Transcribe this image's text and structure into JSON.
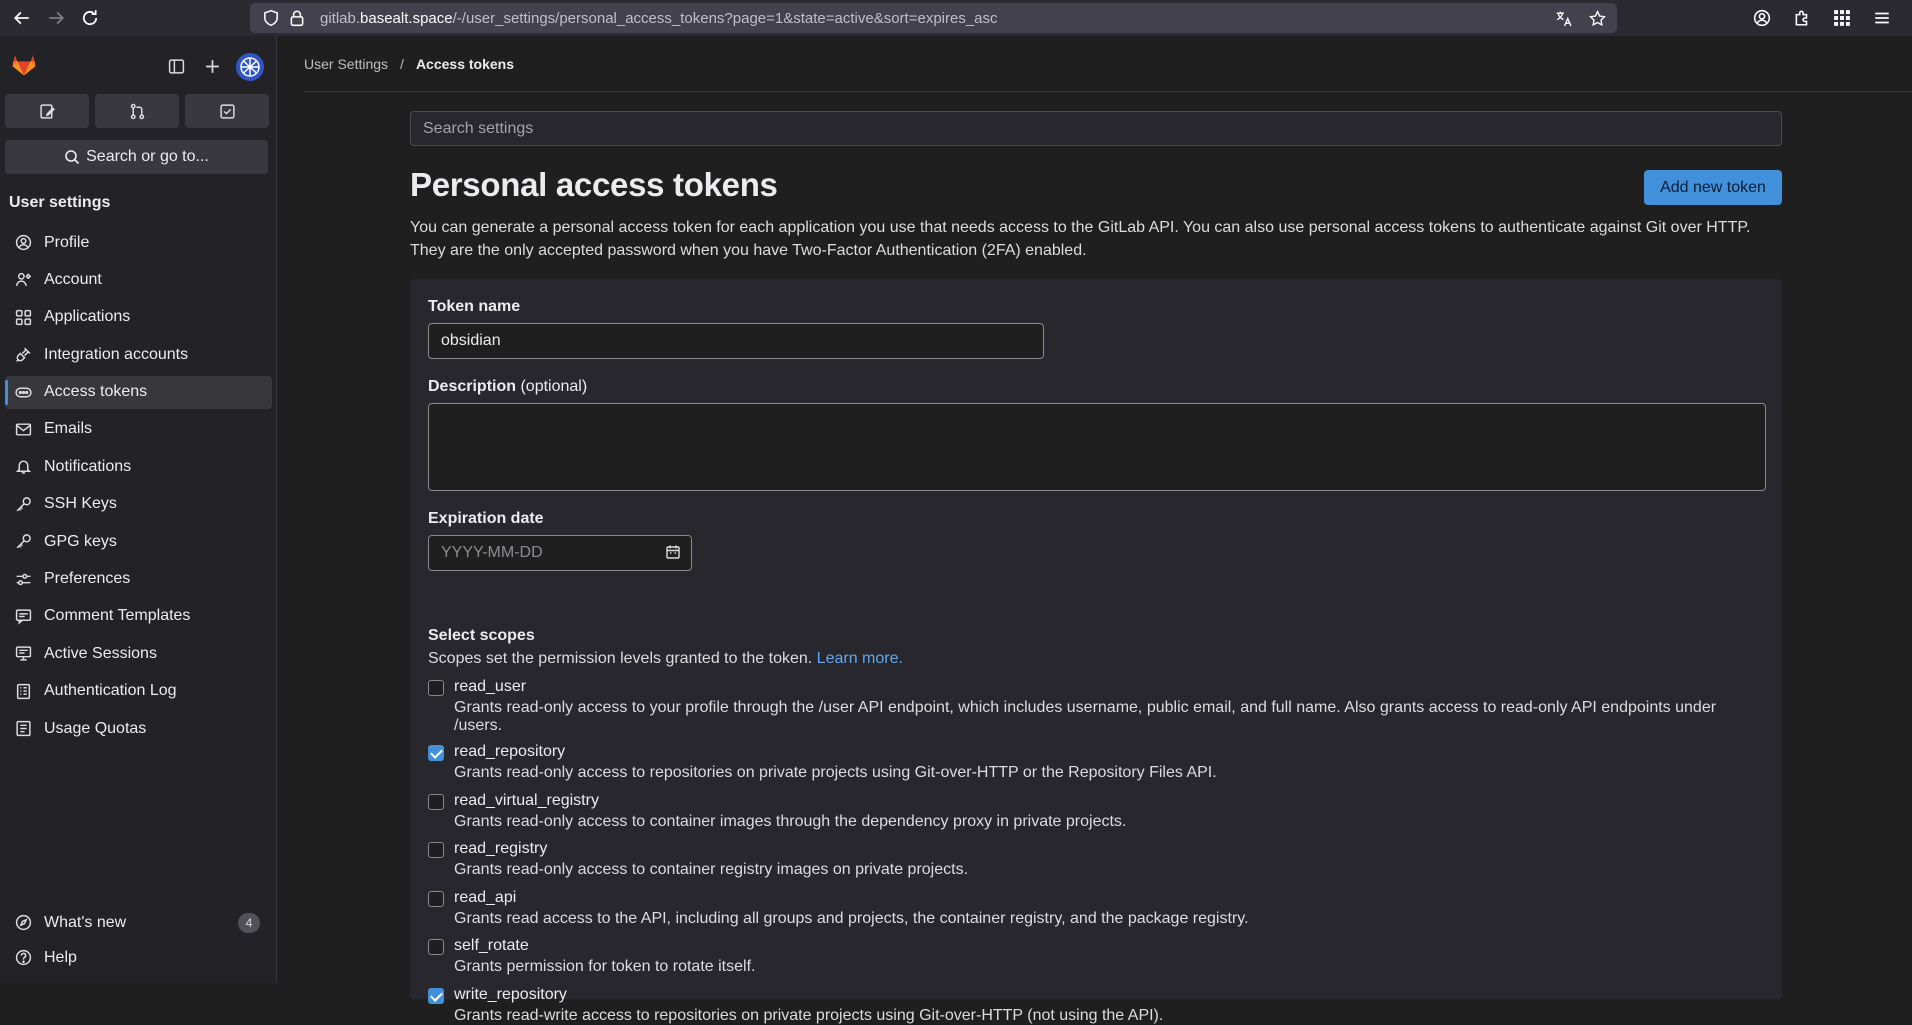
{
  "browser": {
    "url_prefix": "gitlab.",
    "url_domain": "basealt.space",
    "url_path": "/-/user_settings/personal_access_tokens?page=1&state=active&sort=expires_asc"
  },
  "sidebar": {
    "search_label": "Search or go to...",
    "title": "User settings",
    "items": [
      {
        "label": "Profile",
        "icon": "profile-icon"
      },
      {
        "label": "Account",
        "icon": "account-icon"
      },
      {
        "label": "Applications",
        "icon": "applications-icon"
      },
      {
        "label": "Integration accounts",
        "icon": "integration-icon"
      },
      {
        "label": "Access tokens",
        "icon": "token-icon",
        "active": true
      },
      {
        "label": "Emails",
        "icon": "mail-icon"
      },
      {
        "label": "Notifications",
        "icon": "bell-icon"
      },
      {
        "label": "SSH Keys",
        "icon": "key-icon"
      },
      {
        "label": "GPG keys",
        "icon": "key-icon"
      },
      {
        "label": "Preferences",
        "icon": "preferences-icon"
      },
      {
        "label": "Comment Templates",
        "icon": "comment-icon"
      },
      {
        "label": "Active Sessions",
        "icon": "monitor-icon"
      },
      {
        "label": "Authentication Log",
        "icon": "log-icon"
      },
      {
        "label": "Usage Quotas",
        "icon": "quota-icon"
      }
    ],
    "whats_new": "What's new",
    "whats_new_count": "4",
    "help": "Help"
  },
  "breadcrumb": {
    "parent": "User Settings",
    "separator": "/",
    "current": "Access tokens"
  },
  "main": {
    "search_placeholder": "Search settings",
    "title": "Personal access tokens",
    "add_button": "Add new token",
    "intro": "You can generate a personal access token for each application you use that needs access to the GitLab API. You can also use personal access tokens to authenticate against Git over HTTP. They are the only accepted password when you have Two-Factor Authentication (2FA) enabled."
  },
  "form": {
    "token_name_label": "Token name",
    "token_name_value": "obsidian",
    "description_label": "Description",
    "description_optional": "(optional)",
    "expiration_label": "Expiration date",
    "expiration_placeholder": "YYYY-MM-DD",
    "scopes_label": "Select scopes",
    "scopes_help": "Scopes set the permission levels granted to the token.",
    "learn_more": "Learn more.",
    "scopes": [
      {
        "name": "read_user",
        "checked": false,
        "desc": "Grants read-only access to your profile through the /user API endpoint, which includes username, public email, and full name. Also grants access to read-only API endpoints under /users."
      },
      {
        "name": "read_repository",
        "checked": true,
        "desc": "Grants read-only access to repositories on private projects using Git-over-HTTP or the Repository Files API."
      },
      {
        "name": "read_virtual_registry",
        "checked": false,
        "desc": "Grants read-only access to container images through the dependency proxy in private projects."
      },
      {
        "name": "read_registry",
        "checked": false,
        "desc": "Grants read-only access to container registry images on private projects."
      },
      {
        "name": "read_api",
        "checked": false,
        "desc": "Grants read access to the API, including all groups and projects, the container registry, and the package registry."
      },
      {
        "name": "self_rotate",
        "checked": false,
        "desc": "Grants permission for token to rotate itself."
      },
      {
        "name": "write_repository",
        "checked": true,
        "desc": "Grants read-write access to repositories on private projects using Git-over-HTTP (not using the API)."
      }
    ]
  },
  "colors": {
    "accent": "#428fdc",
    "background": "#1f1f1f",
    "sidebar": "#232226"
  }
}
